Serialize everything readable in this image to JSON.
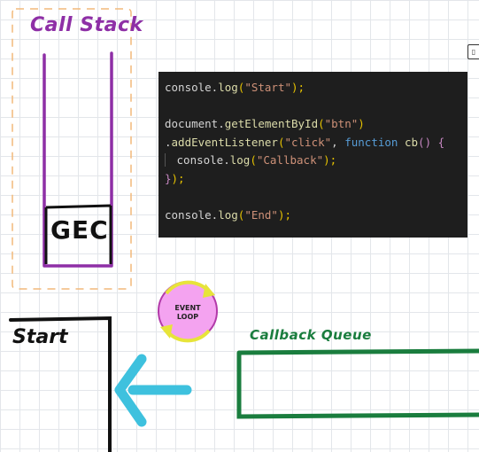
{
  "call_stack": {
    "title": "Call Stack",
    "frame_label": "GEC"
  },
  "output": {
    "label": "Start"
  },
  "event_loop": {
    "label_line1": "EVENT",
    "label_line2": "LOOP"
  },
  "callback_queue": {
    "label": "Callback Queue"
  },
  "code": {
    "lines": [
      [
        {
          "t": "console.",
          "c": "plain"
        },
        {
          "t": "log",
          "c": "fn"
        },
        {
          "t": "(",
          "c": "br"
        },
        {
          "t": "\"Start\"",
          "c": "str"
        },
        {
          "t": ");",
          "c": "br"
        }
      ],
      [],
      [
        {
          "t": "document.",
          "c": "plain"
        },
        {
          "t": "getElementById",
          "c": "fn"
        },
        {
          "t": "(",
          "c": "br"
        },
        {
          "t": "\"btn\"",
          "c": "str"
        },
        {
          "t": ")",
          "c": "br"
        }
      ],
      [
        {
          "t": ".",
          "c": "plain"
        },
        {
          "t": "addEventListener",
          "c": "fn"
        },
        {
          "t": "(",
          "c": "br"
        },
        {
          "t": "\"click\"",
          "c": "str"
        },
        {
          "t": ", ",
          "c": "plain"
        },
        {
          "t": "function",
          "c": "kw"
        },
        {
          "t": " ",
          "c": "plain"
        },
        {
          "t": "cb",
          "c": "fn"
        },
        {
          "t": "() ",
          "c": "br2"
        },
        {
          "t": "{",
          "c": "br2"
        }
      ],
      [
        {
          "t": "",
          "c": "guide"
        },
        {
          "t": "console.",
          "c": "plain"
        },
        {
          "t": "log",
          "c": "fn"
        },
        {
          "t": "(",
          "c": "br"
        },
        {
          "t": "\"Callback\"",
          "c": "str"
        },
        {
          "t": ");",
          "c": "br"
        }
      ],
      [
        {
          "t": "}",
          "c": "br2"
        },
        {
          "t": ");",
          "c": "br"
        }
      ],
      [],
      [
        {
          "t": "console.",
          "c": "plain"
        },
        {
          "t": "log",
          "c": "fn"
        },
        {
          "t": "(",
          "c": "br"
        },
        {
          "t": "\"End\"",
          "c": "str"
        },
        {
          "t": ");",
          "c": "br"
        }
      ]
    ]
  },
  "colors": {
    "call_stack": "#8e2fa6",
    "call_stack_outline": "#f2b97a",
    "event_loop_fill": "#f4a3f0",
    "event_loop_ring": "#e7e43a",
    "callback_queue": "#1a7d3e",
    "arrow": "#3ec1de",
    "output": "#111111"
  }
}
